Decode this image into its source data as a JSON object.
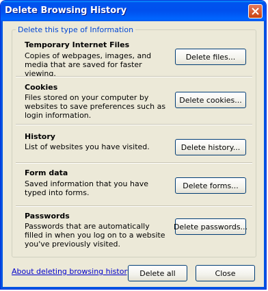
{
  "window": {
    "title": "Delete Browsing History"
  },
  "group": {
    "legend": "Delete this type of Information"
  },
  "sections": [
    {
      "title": "Temporary Internet Files",
      "description": "Copies of webpages, images, and media that are saved for faster viewing.",
      "button": "Delete files..."
    },
    {
      "title": "Cookies",
      "description": "Files stored on your computer by websites to save preferences such as login information.",
      "button": "Delete cookies..."
    },
    {
      "title": "History",
      "description": "List of websites you have visited.",
      "button": "Delete history..."
    },
    {
      "title": "Form data",
      "description": "Saved information that you have typed into forms.",
      "button": "Delete forms..."
    },
    {
      "title": "Passwords",
      "description": "Passwords that are automatically filled in when you log on to a website you've previously visited.",
      "button": "Delete passwords..."
    }
  ],
  "footer": {
    "link": "About deleting browsing history",
    "delete_all": "Delete all",
    "close": "Close"
  },
  "colors": {
    "titlebar": "#0054e3",
    "face": "#ece9d8",
    "legend": "#0046d5",
    "link": "#0000cc"
  }
}
